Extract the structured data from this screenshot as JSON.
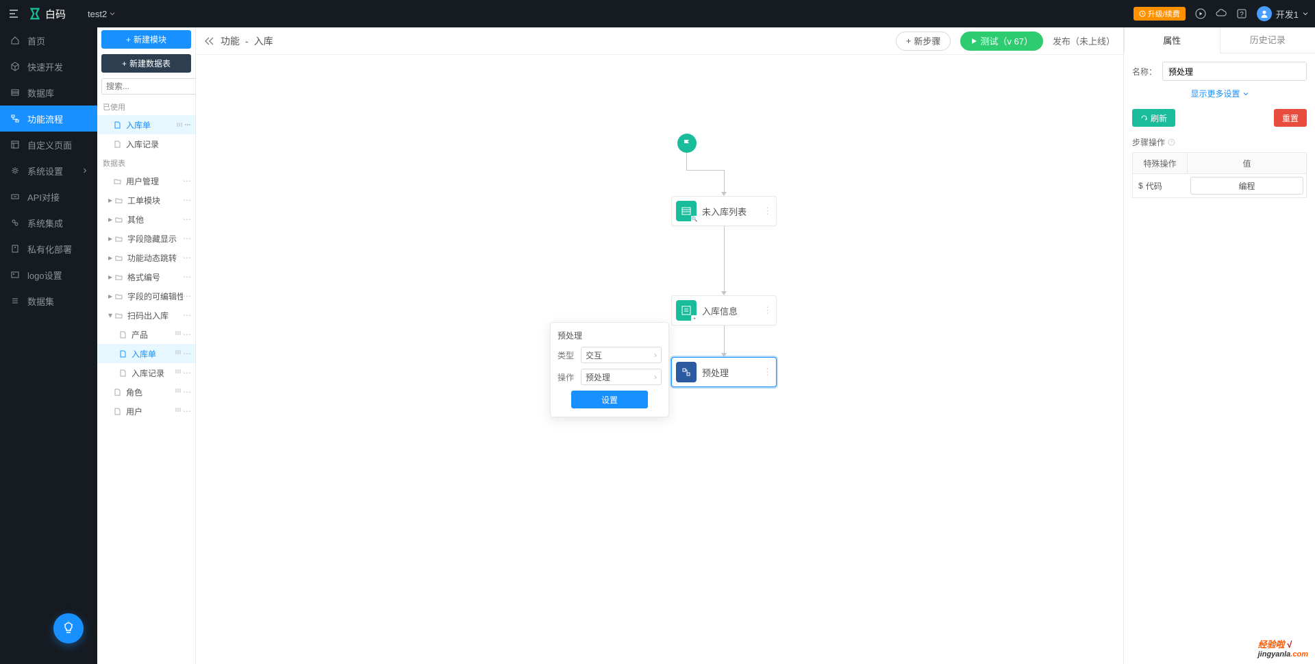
{
  "topbar": {
    "brand": "白码",
    "project": "test2",
    "upgrade": "升级/续费",
    "user": "开发1"
  },
  "sidebar1": {
    "items": [
      {
        "id": "home",
        "label": "首页"
      },
      {
        "id": "quickdev",
        "label": "快速开发"
      },
      {
        "id": "database",
        "label": "数据库"
      },
      {
        "id": "flow",
        "label": "功能流程",
        "active": true
      },
      {
        "id": "custompage",
        "label": "自定义页面"
      },
      {
        "id": "syssetting",
        "label": "系统设置",
        "chevron": true
      },
      {
        "id": "api",
        "label": "API对接"
      },
      {
        "id": "integration",
        "label": "系统集成"
      },
      {
        "id": "private",
        "label": "私有化部署"
      },
      {
        "id": "logo",
        "label": "logo设置"
      },
      {
        "id": "dataset",
        "label": "数据集"
      }
    ]
  },
  "sidebar2": {
    "newModule": "新建模块",
    "newTable": "新建数据表",
    "searchPlaceholder": "搜索...",
    "sectionUsed": "已使用",
    "usedItems": [
      {
        "label": "入库单",
        "active": true,
        "icon": "file"
      },
      {
        "label": "入库记录",
        "icon": "file"
      }
    ],
    "sectionData": "数据表",
    "treeItems": [
      {
        "label": "用户管理",
        "type": "folder",
        "indent": 0
      },
      {
        "label": "工单模块",
        "type": "folder",
        "indent": 0,
        "caret": true
      },
      {
        "label": "其他",
        "type": "folder",
        "indent": 0,
        "caret": true
      },
      {
        "label": "字段隐藏显示",
        "type": "folder",
        "indent": 0,
        "caret": true
      },
      {
        "label": "功能动态跳转",
        "type": "folder",
        "indent": 0,
        "caret": true
      },
      {
        "label": "格式编号",
        "type": "folder",
        "indent": 0,
        "caret": true
      },
      {
        "label": "字段的可编辑性",
        "type": "folder",
        "indent": 0,
        "caret": true
      },
      {
        "label": "扫码出入库",
        "type": "folder",
        "indent": 0,
        "caret": true,
        "open": true
      },
      {
        "label": "产品",
        "type": "file",
        "indent": 1
      },
      {
        "label": "入库单",
        "type": "file",
        "indent": 1,
        "active": true
      },
      {
        "label": "入库记录",
        "type": "file",
        "indent": 1
      },
      {
        "label": "角色",
        "type": "file",
        "indent": 0
      },
      {
        "label": "用户",
        "type": "file",
        "indent": 0
      }
    ]
  },
  "header": {
    "crumb1": "功能",
    "crumb2": "入库",
    "newStep": "新步骤",
    "test": "测试（v 67）",
    "publish": "发布（未上线）"
  },
  "flow": {
    "node1": "未入库列表",
    "node2": "入库信息",
    "node3": "预处理"
  },
  "popup": {
    "title": "预处理",
    "typeLabel": "类型",
    "typeValue": "交互",
    "opLabel": "操作",
    "opValue": "预处理",
    "btn": "设置"
  },
  "rightpanel": {
    "tab1": "属性",
    "tab2": "历史记录",
    "nameLabel": "名称：",
    "nameValue": "预处理",
    "moreLink": "显示更多设置",
    "refresh": "刷新",
    "reset": "重置",
    "stepOps": "步骤操作",
    "col1": "特殊操作",
    "col2": "值",
    "codeLabel": "代码",
    "codeBtn": "编程"
  },
  "watermark": {
    "a": "经验啦",
    "b": "jingyanla",
    "c": ".com",
    "check": "√"
  }
}
